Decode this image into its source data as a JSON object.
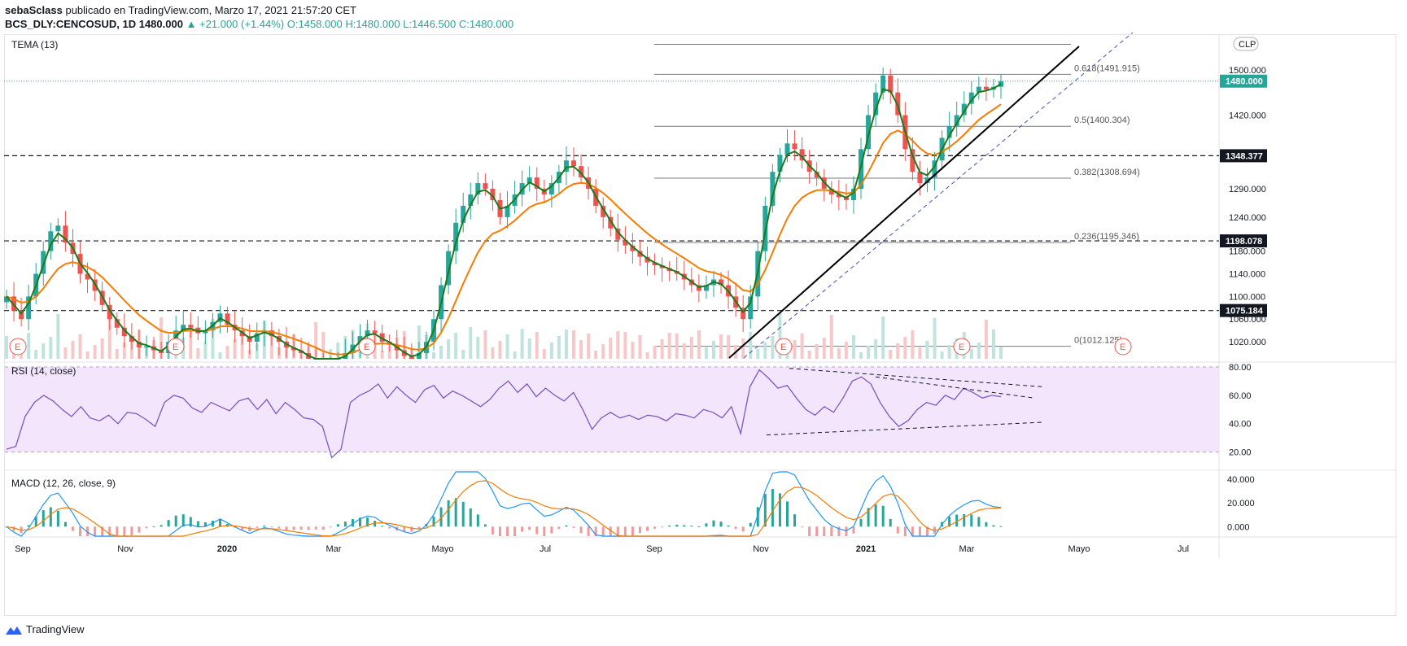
{
  "header": {
    "user": "sebaSclass",
    "published_text": "publicado en TradingView.com, Marzo 17, 2021 21:57:20 CET",
    "symbol_line": "BCS_DLY:CENCOSUD, 1D",
    "price": "1480.000",
    "change": "▲ +21.000 (+1.44%)",
    "ohlc": "O:1458.000 H:1480.000 L:1446.500 C:1480.000"
  },
  "currency_badge": "CLP",
  "colors": {
    "up": "#26a69a",
    "down": "#ef5350",
    "tema": "#1b7a1b",
    "ema": "#f57c00",
    "rsi": "#7e57c2",
    "rsi_band": "#f3e5fb",
    "macd": "#2196f3",
    "signal": "#f57c00",
    "price_label_bg": "#26a69a"
  },
  "footer": {
    "brand": "TradingView"
  },
  "chart_data": [
    {
      "type": "candlestick",
      "title": "TEMA (13)",
      "y_ticks": [
        "1500.000",
        "1420.000",
        "1290.000",
        "1240.000",
        "1180.000",
        "1140.000",
        "1100.000",
        "1060.000",
        "1020.000"
      ],
      "ylim": [
        990,
        1560
      ],
      "x_ticks": [
        "Sep",
        "Nov",
        "2020",
        "Mar",
        "Mayo",
        "Jul",
        "Sep",
        "Nov",
        "2021",
        "Mar",
        "Mayo",
        "Jul"
      ],
      "current_price_label": "1480.000",
      "horizontal_levels": [
        "1348.377",
        "1198.078",
        "1075.184"
      ],
      "fib_levels": [
        {
          "label": "0.618(1491.915)",
          "value": 1491.915
        },
        {
          "label": "0.5(1400.304)",
          "value": 1400.304
        },
        {
          "label": "0.382(1308.694)",
          "value": 1308.694
        },
        {
          "label": "0.236(1195.346)",
          "value": 1195.346
        },
        {
          "label": "0(1012.125)",
          "value": 1012.125
        }
      ],
      "earnings_markers": [
        "E",
        "E",
        "E",
        "E",
        "E",
        "E"
      ],
      "close_series": [
        1100,
        1075,
        1060,
        1100,
        1140,
        1180,
        1215,
        1225,
        1195,
        1175,
        1140,
        1130,
        1110,
        1085,
        1060,
        1045,
        1030,
        1020,
        1010,
        1012,
        1005,
        1000,
        1020,
        1040,
        1050,
        1045,
        1035,
        1040,
        1055,
        1070,
        1050,
        1040,
        1030,
        1020,
        1035,
        1040,
        1030,
        1020,
        1010,
        1005,
        1000,
        990,
        985,
        975,
        980,
        990,
        1000,
        1015,
        1030,
        1040,
        1035,
        1020,
        1015,
        1005,
        995,
        990,
        1000,
        1020,
        1060,
        1120,
        1180,
        1230,
        1260,
        1280,
        1300,
        1290,
        1270,
        1240,
        1260,
        1280,
        1300,
        1310,
        1290,
        1280,
        1300,
        1320,
        1340,
        1330,
        1310,
        1290,
        1260,
        1240,
        1220,
        1200,
        1190,
        1180,
        1170,
        1160,
        1155,
        1150,
        1145,
        1140,
        1130,
        1120,
        1110,
        1120,
        1130,
        1120,
        1100,
        1080,
        1060,
        1100,
        1180,
        1260,
        1320,
        1350,
        1370,
        1360,
        1340,
        1320,
        1310,
        1290,
        1280,
        1275,
        1270,
        1290,
        1360,
        1420,
        1460,
        1490,
        1460,
        1420,
        1360,
        1320,
        1300,
        1310,
        1340,
        1380,
        1400,
        1420,
        1440,
        1460,
        1470,
        1465,
        1470,
        1480
      ]
    },
    {
      "type": "line",
      "title": "RSI (14, close)",
      "y_ticks": [
        "80.00",
        "60.00",
        "40.00",
        "20.00"
      ],
      "ylim": [
        10,
        80
      ],
      "values": [
        22,
        24,
        45,
        55,
        60,
        56,
        50,
        45,
        52,
        44,
        42,
        46,
        40,
        48,
        47,
        43,
        38,
        55,
        60,
        58,
        51,
        48,
        55,
        52,
        49,
        56,
        58,
        50,
        57,
        47,
        55,
        50,
        44,
        43,
        38,
        16,
        22,
        55,
        60,
        63,
        68,
        58,
        66,
        60,
        55,
        64,
        67,
        58,
        63,
        60,
        56,
        52,
        57,
        65,
        70,
        62,
        68,
        59,
        65,
        60,
        56,
        62,
        50,
        36,
        44,
        48,
        44,
        46,
        43,
        46,
        45,
        42,
        47,
        46,
        44,
        50,
        48,
        44,
        52,
        33,
        66,
        78,
        72,
        65,
        67,
        58,
        50,
        46,
        52,
        48,
        58,
        70,
        73,
        68,
        55,
        45,
        38,
        42,
        50,
        55,
        53,
        60,
        57,
        65,
        62,
        58,
        60,
        59
      ]
    },
    {
      "type": "bar",
      "title": "MACD (12, 26, close, 9)",
      "y_ticks": [
        "40.000",
        "20.000",
        "0.000"
      ],
      "ylim": [
        -8,
        46
      ]
    }
  ]
}
